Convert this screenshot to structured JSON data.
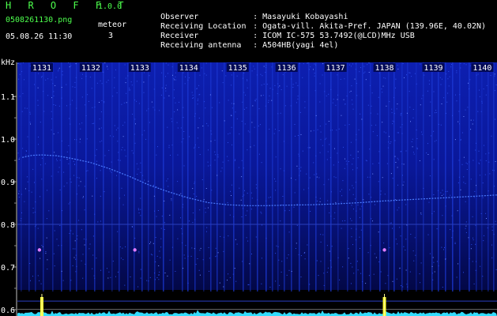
{
  "app": {
    "title": "H R O F F T",
    "version": "1.0.0",
    "filename": "0508261130.png",
    "datetime": "05.08.26 11:30",
    "meteor_label": "meteor",
    "meteor_count": "3"
  },
  "info": [
    {
      "key": "Observer",
      "value": "Masayuki Kobayashi"
    },
    {
      "key": "Receiving Location",
      "value": "Ogata-vill. Akita-Pref. JAPAN (139.96E, 40.02N)"
    },
    {
      "key": "Receiver",
      "value": "ICOM IC-575 53.7492(@LCD)MHz USB"
    },
    {
      "key": "Receiving antenna",
      "value": "A504HB(yagi 4el)"
    }
  ],
  "colors": {
    "background": "#000000",
    "spectrogram": "#0a1a9e",
    "green_text": "#4dff4d",
    "signal": "#ffff33",
    "noise_trace": "#33ddff"
  },
  "chart_data": {
    "type": "heatmap",
    "ylabel": "kHz",
    "y_ticks": [
      "1.1",
      "1.0",
      "0.9",
      "0.8",
      "0.7",
      "0.6"
    ],
    "x_ticks": [
      "1131",
      "1132",
      "1133",
      "1134",
      "1135",
      "1136",
      "1137",
      "1138",
      "1139",
      "1140"
    ],
    "xlim": [
      1130.5,
      1140.3
    ],
    "ylim": [
      0.585,
      1.18
    ],
    "trace": {
      "x": [
        1130.6,
        1130.8,
        1131.0,
        1131.3,
        1131.6,
        1132.0,
        1132.4,
        1132.8,
        1133.2,
        1133.6,
        1134.0,
        1134.4,
        1134.8,
        1135.2,
        1135.6,
        1136.0,
        1136.5,
        1137.0,
        1137.5,
        1138.0,
        1138.5,
        1139.0,
        1139.5,
        1140.0,
        1140.3
      ],
      "y": [
        0.957,
        0.962,
        0.963,
        0.961,
        0.955,
        0.945,
        0.93,
        0.912,
        0.892,
        0.876,
        0.862,
        0.851,
        0.846,
        0.844,
        0.844,
        0.845,
        0.846,
        0.848,
        0.851,
        0.855,
        0.858,
        0.861,
        0.864,
        0.867,
        0.869
      ]
    },
    "meteors": [
      {
        "x": 1130.95,
        "y": 0.74
      },
      {
        "x": 1138.0,
        "y": 0.74
      },
      {
        "x": 1132.9,
        "y": 0.74
      }
    ],
    "bottom_signals": [
      1131.0,
      1138.0
    ]
  }
}
